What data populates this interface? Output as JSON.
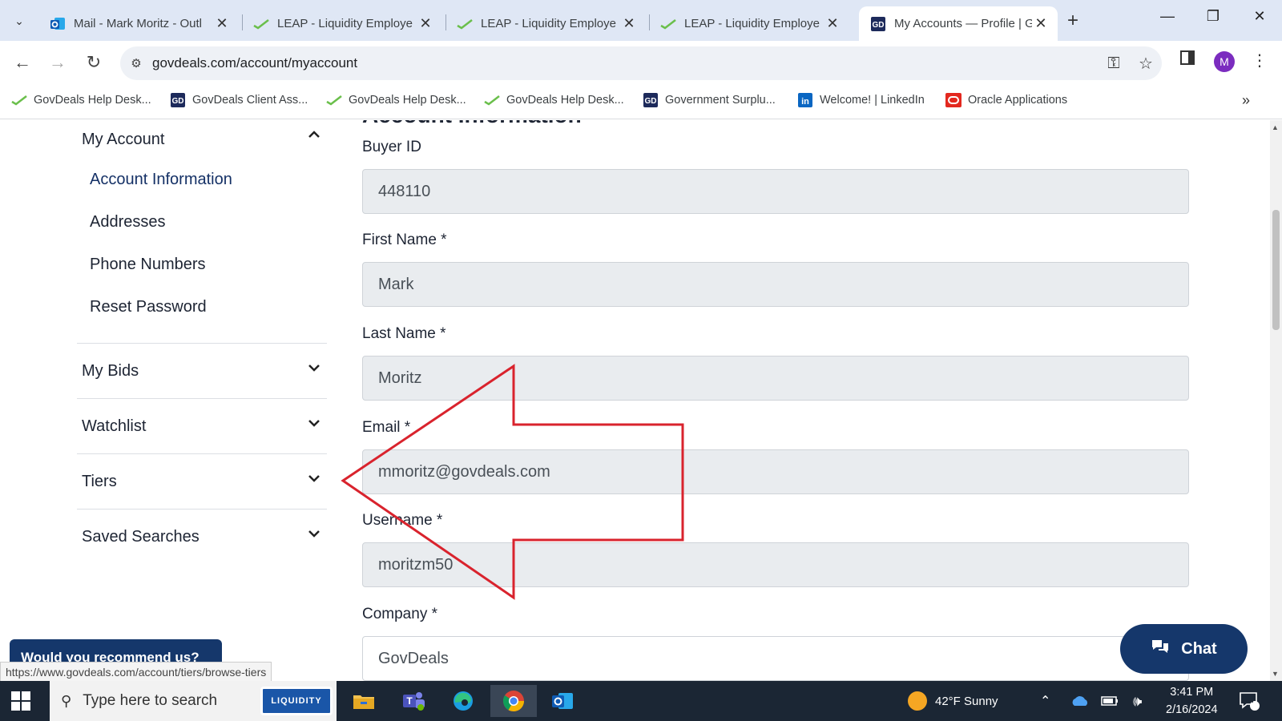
{
  "browser": {
    "tabs": [
      {
        "title": "Mail - Mark Moritz - Outl",
        "icon": "outlook-icon"
      },
      {
        "title": "LEAP - Liquidity Employe",
        "icon": "leap-icon"
      },
      {
        "title": "LEAP - Liquidity Employe",
        "icon": "leap-icon"
      },
      {
        "title": "LEAP - Liquidity Employe",
        "icon": "leap-icon"
      },
      {
        "title": "My Accounts — Profile | G",
        "icon": "govdeals-icon",
        "active": true
      }
    ],
    "url": "govdeals.com/account/myaccount",
    "profile_initial": "M",
    "bookmarks": [
      {
        "label": "GovDeals Help Desk...",
        "icon": "leap-icon"
      },
      {
        "label": "GovDeals Client Ass...",
        "icon": "govdeals-icon"
      },
      {
        "label": "GovDeals Help Desk...",
        "icon": "leap-icon"
      },
      {
        "label": "GovDeals Help Desk...",
        "icon": "leap-icon"
      },
      {
        "label": "Government Surplu...",
        "icon": "govdeals-icon"
      },
      {
        "label": "Welcome! | LinkedIn",
        "icon": "linkedin-icon"
      },
      {
        "label": "Oracle Applications",
        "icon": "oracle-icon"
      }
    ]
  },
  "sidebar": {
    "my_account": "My Account",
    "sub_items": [
      {
        "label": "Account Information",
        "active": true
      },
      {
        "label": "Addresses"
      },
      {
        "label": "Phone Numbers"
      },
      {
        "label": "Reset Password"
      }
    ],
    "sections": [
      {
        "label": "My Bids"
      },
      {
        "label": "Watchlist"
      },
      {
        "label": "Tiers"
      },
      {
        "label": "Saved Searches"
      }
    ]
  },
  "form": {
    "title": "Account Information",
    "fields": [
      {
        "label": "Buyer ID",
        "value": "448110"
      },
      {
        "label": "First Name *",
        "value": "Mark"
      },
      {
        "label": "Last Name *",
        "value": "Moritz"
      },
      {
        "label": "Email *",
        "value": "mmoritz@govdeals.com"
      },
      {
        "label": "Username *",
        "value": "moritzm50"
      },
      {
        "label": "Company *",
        "value": "GovDeals"
      }
    ]
  },
  "survey_banner": "Would you recommend us?",
  "status_url": "https://www.govdeals.com/account/tiers/browse-tiers",
  "chat_label": "Chat",
  "annotation": {
    "color": "#d9232d"
  },
  "taskbar": {
    "search_placeholder": "Type here to search",
    "liquidity_label": "LIQUIDITY",
    "weather": "42°F  Sunny",
    "time": "3:41 PM",
    "date": "2/16/2024",
    "notifications": "7"
  }
}
